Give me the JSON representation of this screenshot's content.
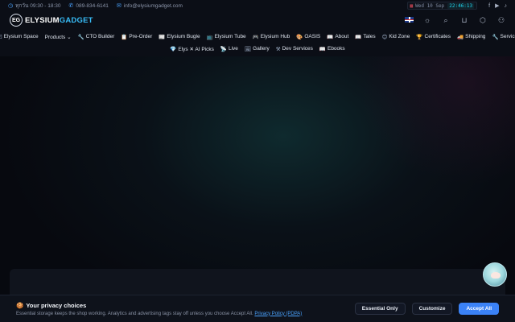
{
  "topbar": {
    "hours": "ทุกวัน 09:30 - 18:30",
    "phone": "089-834-6141",
    "email": "info@elysiumgadget.com",
    "clock_date": "Wed 10 Sep",
    "clock_time": "22:46:13"
  },
  "brand": {
    "name_a": "ELYSIUM",
    "name_b": "GADGET",
    "mark": "EG"
  },
  "nav": {
    "row1": [
      {
        "icon": "☑",
        "label": "Elysium Space"
      },
      {
        "icon": "",
        "label": "Products ⌄"
      },
      {
        "icon": "🔧",
        "label": "CTO Builder"
      },
      {
        "icon": "📋",
        "label": "Pre-Order"
      },
      {
        "icon": "📰",
        "label": "Elysium Bugle"
      },
      {
        "icon": "📺",
        "label": "Elysium Tube"
      },
      {
        "icon": "🎮",
        "label": "Elysium Hub"
      },
      {
        "icon": "🎨",
        "label": "OASIS"
      },
      {
        "icon": "📖",
        "label": "About"
      },
      {
        "icon": "📖",
        "label": "Tales"
      },
      {
        "icon": "😊",
        "label": "Kid Zone"
      },
      {
        "icon": "🏆",
        "label": "Certificates"
      },
      {
        "icon": "🚚",
        "label": "Shipping"
      },
      {
        "icon": "🔧",
        "label": "Service"
      }
    ],
    "row2": [
      {
        "icon": "💎",
        "label": "Elys ✕ AI Picks"
      },
      {
        "icon": "📡",
        "label": "Live"
      },
      {
        "icon": "🖼",
        "label": "Gallery"
      },
      {
        "icon": "⚒",
        "label": "Dev Services"
      },
      {
        "icon": "📖",
        "label": "Ebooks"
      }
    ]
  },
  "cookie": {
    "icon": "🍪",
    "title": "Your privacy choices",
    "desc": "Essential storage keeps the shop working. Analytics and advertising tags stay off unless you choose Accept All.",
    "link": "Privacy Policy (PDPA)",
    "btn_essential": "Essential Only",
    "btn_customize": "Customize",
    "btn_accept": "Accept All"
  },
  "icons": {
    "clock": "clock-icon",
    "phone": "phone-icon",
    "mail": "mail-icon",
    "language": "uk-flag-icon",
    "theme": "sun-icon",
    "search": "search-icon",
    "cart": "cart-icon",
    "box": "package-icon",
    "user": "user-icon"
  },
  "colors": {
    "accent": "#38bdf8",
    "primary_button": "#3b82f6",
    "clock_time": "#22d3ee"
  }
}
